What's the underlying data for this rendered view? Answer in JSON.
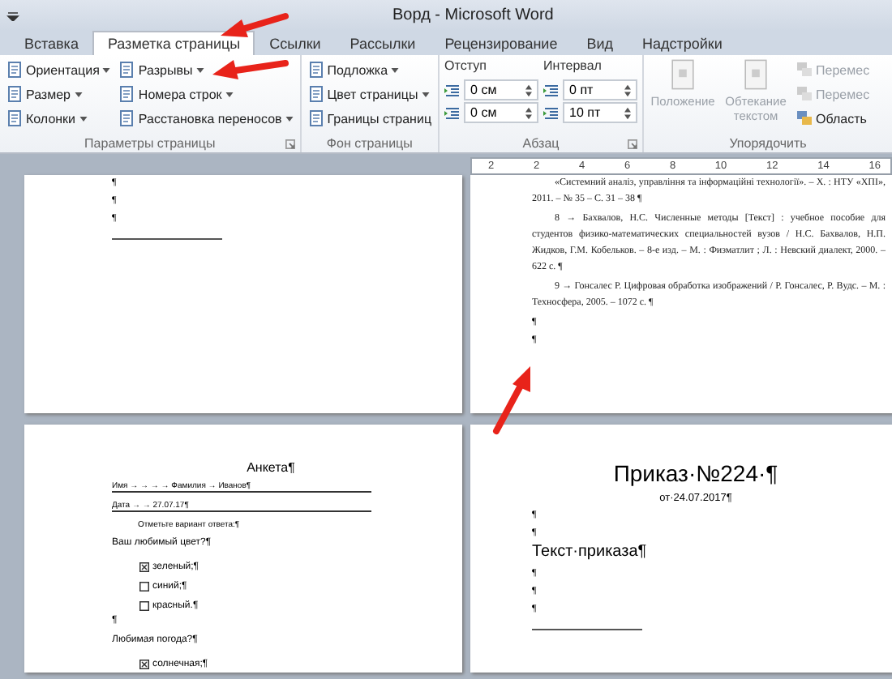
{
  "window": {
    "title": "Ворд - Microsoft Word"
  },
  "tabs": [
    {
      "label": "Вставка",
      "selected": false
    },
    {
      "label": "Разметка страницы",
      "selected": true
    },
    {
      "label": "Ссылки",
      "selected": false
    },
    {
      "label": "Рассылки",
      "selected": false
    },
    {
      "label": "Рецензирование",
      "selected": false
    },
    {
      "label": "Вид",
      "selected": false
    },
    {
      "label": "Надстройки",
      "selected": false
    }
  ],
  "ribbon": {
    "groups": [
      {
        "kind": "buttons",
        "label": "Параметры страницы",
        "launcher": true,
        "columns": [
          [
            {
              "label": "Ориентация",
              "dropdown": true
            },
            {
              "label": "Размер",
              "dropdown": true
            },
            {
              "label": "Колонки",
              "dropdown": true
            }
          ],
          [
            {
              "label": "Разрывы",
              "dropdown": true
            },
            {
              "label": "Номера строк",
              "dropdown": true
            },
            {
              "label": "Расстановка переносов",
              "dropdown": true
            }
          ]
        ]
      },
      {
        "kind": "buttons",
        "label": "Фон страницы",
        "launcher": false,
        "columns": [
          [
            {
              "label": "Подложка",
              "dropdown": true
            },
            {
              "label": "Цвет страницы",
              "dropdown": true
            },
            {
              "label": "Границы страниц",
              "dropdown": false
            }
          ]
        ]
      },
      {
        "kind": "spinners",
        "label": "Абзац",
        "launcher": true,
        "columns": [
          {
            "heading": "Отступ",
            "fields": [
              "0 см",
              "0 см"
            ]
          },
          {
            "heading": "Интервал",
            "fields": [
              "0 пт",
              "10 пт"
            ]
          }
        ]
      },
      {
        "kind": "large",
        "label": "Упорядочить",
        "launcher": false,
        "large": [
          {
            "label": "Положение",
            "disabled": true
          },
          {
            "label": "Обтекание текстом",
            "disabled": true
          }
        ],
        "small": [
          {
            "label": "Перемес",
            "disabled": true
          },
          {
            "label": "Перемес",
            "disabled": true
          },
          {
            "label": "Область",
            "disabled": false
          }
        ]
      }
    ]
  },
  "ruler": {
    "labels": [
      "2",
      "2",
      "4",
      "6",
      "8",
      "10",
      "12",
      "14",
      "16"
    ]
  },
  "pages": [
    {
      "blocks": [
        {
          "kind": "mark",
          "text": "¶"
        },
        {
          "kind": "mark",
          "text": "¶"
        },
        {
          "kind": "mark",
          "text": "¶"
        },
        {
          "kind": "separator"
        }
      ]
    },
    {
      "blocks": [
        {
          "kind": "ref",
          "text": "«Системний аналіз, управління та інформаційні технології». – Х. : НТУ «ХПІ», 2011. – № 35 – С. 31 – 38 ¶"
        },
        {
          "kind": "ref",
          "text": "8 → Бахвалов, Н.С. Численные методы [Текст] : учебное пособие для студентов физико-математических специальностей вузов / Н.С. Бахвалов, Н.П. Жидков, Г.М. Кобельков. – 8-е изд. – М. : Физматлит ; Л. : Невский диалект, 2000. – 622 с. ¶"
        },
        {
          "kind": "ref",
          "text": "9 → Гонсалес Р. Цифровая обработка изображений / Р. Гонсалес, Р. Вудс. – М. : Техносфера, 2005. – 1072 с. ¶"
        },
        {
          "kind": "mark",
          "text": "¶"
        },
        {
          "kind": "mark",
          "text": "¶"
        }
      ]
    },
    {
      "blocks": [
        {
          "kind": "title",
          "text": "Анкета¶"
        },
        {
          "kind": "form_line",
          "text": "Имя → → → → Фамилия → Иванов¶"
        },
        {
          "kind": "form_line",
          "text": "Дата → → 27.07.17¶"
        },
        {
          "kind": "hint",
          "text": "Отметьте вариант ответа:¶"
        },
        {
          "kind": "line",
          "text": "Ваш любимый цвет?¶"
        },
        {
          "kind": "check",
          "text": "зеленый;¶",
          "checked": true
        },
        {
          "kind": "check",
          "text": "синий;¶",
          "checked": false
        },
        {
          "kind": "check",
          "text": "красный.¶",
          "checked": false
        },
        {
          "kind": "line",
          "text": "¶"
        },
        {
          "kind": "line",
          "text": "Любимая погода?¶"
        },
        {
          "kind": "check",
          "text": "солнечная;¶",
          "checked": true
        }
      ]
    },
    {
      "blocks": [
        {
          "kind": "big_title",
          "text": "Приказ·№224·¶"
        },
        {
          "kind": "subtitle",
          "text": "от·24.07.2017¶"
        },
        {
          "kind": "mark",
          "text": "¶"
        },
        {
          "kind": "mark",
          "text": "¶"
        },
        {
          "kind": "body",
          "text": "Текст·приказа¶"
        },
        {
          "kind": "mark",
          "text": "¶"
        },
        {
          "kind": "mark",
          "text": "¶"
        },
        {
          "kind": "mark",
          "text": "¶"
        },
        {
          "kind": "separator"
        }
      ]
    }
  ]
}
